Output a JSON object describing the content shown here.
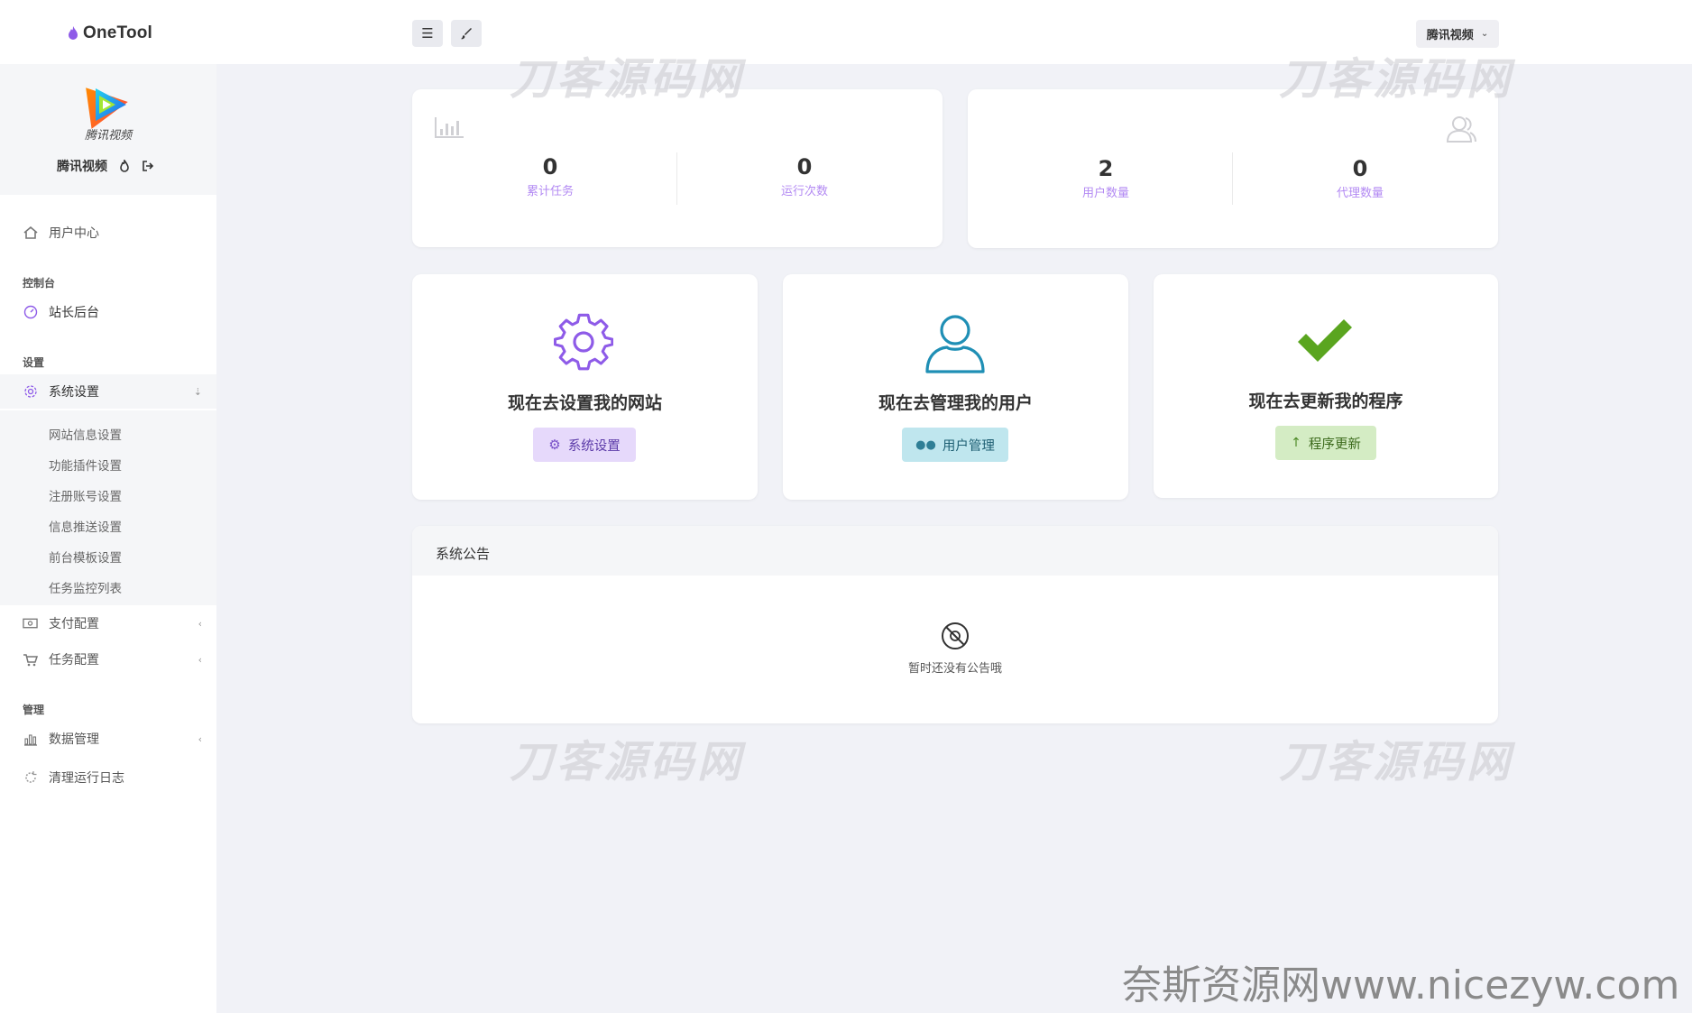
{
  "app": {
    "brand": "OneTool"
  },
  "topbar": {
    "menu_icon": "menu-icon",
    "theme_icon": "brush-icon",
    "site_select": "腾讯视频"
  },
  "profile": {
    "logo_text": "腾讯视频",
    "name": "腾讯视频"
  },
  "sidebar": {
    "user_center": "用户中心",
    "section_console": "控制台",
    "admin_panel": "站长后台",
    "section_settings": "设置",
    "system_settings": "系统设置",
    "sub_items": [
      "网站信息设置",
      "功能插件设置",
      "注册账号设置",
      "信息推送设置",
      "前台模板设置",
      "任务监控列表"
    ],
    "payment_config": "支付配置",
    "task_config": "任务配置",
    "section_manage": "管理",
    "data_manage": "数据管理",
    "clear_logs": "清理运行日志"
  },
  "stats": {
    "left": [
      {
        "value": "0",
        "label": "累计任务"
      },
      {
        "value": "0",
        "label": "运行次数"
      }
    ],
    "right": [
      {
        "value": "2",
        "label": "用户数量"
      },
      {
        "value": "0",
        "label": "代理数量"
      }
    ]
  },
  "actions": [
    {
      "title": "现在去设置我的网站",
      "button": "系统设置",
      "color": "#8e5be8"
    },
    {
      "title": "现在去管理我的用户",
      "button": "用户管理",
      "color": "#1f8fb5"
    },
    {
      "title": "现在去更新我的程序",
      "button": "程序更新",
      "color": "#5aa51f"
    }
  ],
  "notice": {
    "title": "系统公告",
    "empty": "暂时还没有公告哦"
  },
  "watermarks": {
    "text": "刀客源码网",
    "footer": "奈斯资源网www.nicezyw.com"
  },
  "colors": {
    "accent": "#b38af3",
    "background": "#f1f2f7"
  }
}
